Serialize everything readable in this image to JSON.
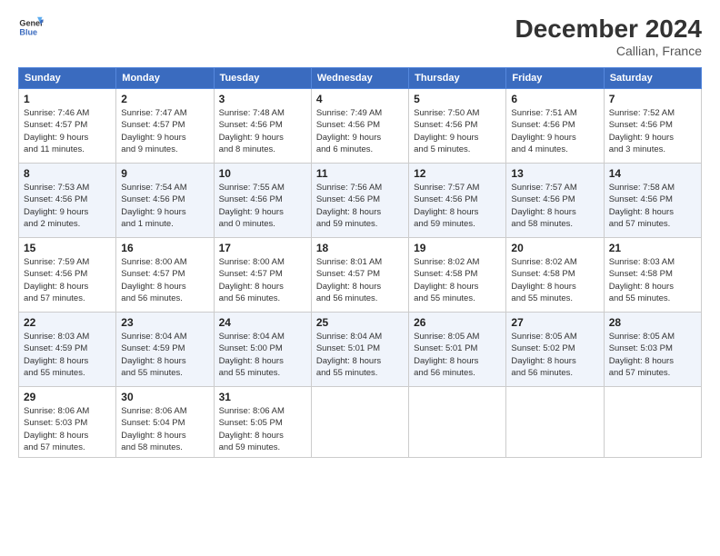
{
  "header": {
    "logo_line1": "General",
    "logo_line2": "Blue",
    "title": "December 2024",
    "subtitle": "Callian, France"
  },
  "columns": [
    "Sunday",
    "Monday",
    "Tuesday",
    "Wednesday",
    "Thursday",
    "Friday",
    "Saturday"
  ],
  "weeks": [
    [
      {
        "day": "1",
        "info": "Sunrise: 7:46 AM\nSunset: 4:57 PM\nDaylight: 9 hours\nand 11 minutes."
      },
      {
        "day": "2",
        "info": "Sunrise: 7:47 AM\nSunset: 4:57 PM\nDaylight: 9 hours\nand 9 minutes."
      },
      {
        "day": "3",
        "info": "Sunrise: 7:48 AM\nSunset: 4:56 PM\nDaylight: 9 hours\nand 8 minutes."
      },
      {
        "day": "4",
        "info": "Sunrise: 7:49 AM\nSunset: 4:56 PM\nDaylight: 9 hours\nand 6 minutes."
      },
      {
        "day": "5",
        "info": "Sunrise: 7:50 AM\nSunset: 4:56 PM\nDaylight: 9 hours\nand 5 minutes."
      },
      {
        "day": "6",
        "info": "Sunrise: 7:51 AM\nSunset: 4:56 PM\nDaylight: 9 hours\nand 4 minutes."
      },
      {
        "day": "7",
        "info": "Sunrise: 7:52 AM\nSunset: 4:56 PM\nDaylight: 9 hours\nand 3 minutes."
      }
    ],
    [
      {
        "day": "8",
        "info": "Sunrise: 7:53 AM\nSunset: 4:56 PM\nDaylight: 9 hours\nand 2 minutes."
      },
      {
        "day": "9",
        "info": "Sunrise: 7:54 AM\nSunset: 4:56 PM\nDaylight: 9 hours\nand 1 minute."
      },
      {
        "day": "10",
        "info": "Sunrise: 7:55 AM\nSunset: 4:56 PM\nDaylight: 9 hours\nand 0 minutes."
      },
      {
        "day": "11",
        "info": "Sunrise: 7:56 AM\nSunset: 4:56 PM\nDaylight: 8 hours\nand 59 minutes."
      },
      {
        "day": "12",
        "info": "Sunrise: 7:57 AM\nSunset: 4:56 PM\nDaylight: 8 hours\nand 59 minutes."
      },
      {
        "day": "13",
        "info": "Sunrise: 7:57 AM\nSunset: 4:56 PM\nDaylight: 8 hours\nand 58 minutes."
      },
      {
        "day": "14",
        "info": "Sunrise: 7:58 AM\nSunset: 4:56 PM\nDaylight: 8 hours\nand 57 minutes."
      }
    ],
    [
      {
        "day": "15",
        "info": "Sunrise: 7:59 AM\nSunset: 4:56 PM\nDaylight: 8 hours\nand 57 minutes."
      },
      {
        "day": "16",
        "info": "Sunrise: 8:00 AM\nSunset: 4:57 PM\nDaylight: 8 hours\nand 56 minutes."
      },
      {
        "day": "17",
        "info": "Sunrise: 8:00 AM\nSunset: 4:57 PM\nDaylight: 8 hours\nand 56 minutes."
      },
      {
        "day": "18",
        "info": "Sunrise: 8:01 AM\nSunset: 4:57 PM\nDaylight: 8 hours\nand 56 minutes."
      },
      {
        "day": "19",
        "info": "Sunrise: 8:02 AM\nSunset: 4:58 PM\nDaylight: 8 hours\nand 55 minutes."
      },
      {
        "day": "20",
        "info": "Sunrise: 8:02 AM\nSunset: 4:58 PM\nDaylight: 8 hours\nand 55 minutes."
      },
      {
        "day": "21",
        "info": "Sunrise: 8:03 AM\nSunset: 4:58 PM\nDaylight: 8 hours\nand 55 minutes."
      }
    ],
    [
      {
        "day": "22",
        "info": "Sunrise: 8:03 AM\nSunset: 4:59 PM\nDaylight: 8 hours\nand 55 minutes."
      },
      {
        "day": "23",
        "info": "Sunrise: 8:04 AM\nSunset: 4:59 PM\nDaylight: 8 hours\nand 55 minutes."
      },
      {
        "day": "24",
        "info": "Sunrise: 8:04 AM\nSunset: 5:00 PM\nDaylight: 8 hours\nand 55 minutes."
      },
      {
        "day": "25",
        "info": "Sunrise: 8:04 AM\nSunset: 5:01 PM\nDaylight: 8 hours\nand 55 minutes."
      },
      {
        "day": "26",
        "info": "Sunrise: 8:05 AM\nSunset: 5:01 PM\nDaylight: 8 hours\nand 56 minutes."
      },
      {
        "day": "27",
        "info": "Sunrise: 8:05 AM\nSunset: 5:02 PM\nDaylight: 8 hours\nand 56 minutes."
      },
      {
        "day": "28",
        "info": "Sunrise: 8:05 AM\nSunset: 5:03 PM\nDaylight: 8 hours\nand 57 minutes."
      }
    ],
    [
      {
        "day": "29",
        "info": "Sunrise: 8:06 AM\nSunset: 5:03 PM\nDaylight: 8 hours\nand 57 minutes."
      },
      {
        "day": "30",
        "info": "Sunrise: 8:06 AM\nSunset: 5:04 PM\nDaylight: 8 hours\nand 58 minutes."
      },
      {
        "day": "31",
        "info": "Sunrise: 8:06 AM\nSunset: 5:05 PM\nDaylight: 8 hours\nand 59 minutes."
      },
      {
        "day": "",
        "info": ""
      },
      {
        "day": "",
        "info": ""
      },
      {
        "day": "",
        "info": ""
      },
      {
        "day": "",
        "info": ""
      }
    ]
  ]
}
